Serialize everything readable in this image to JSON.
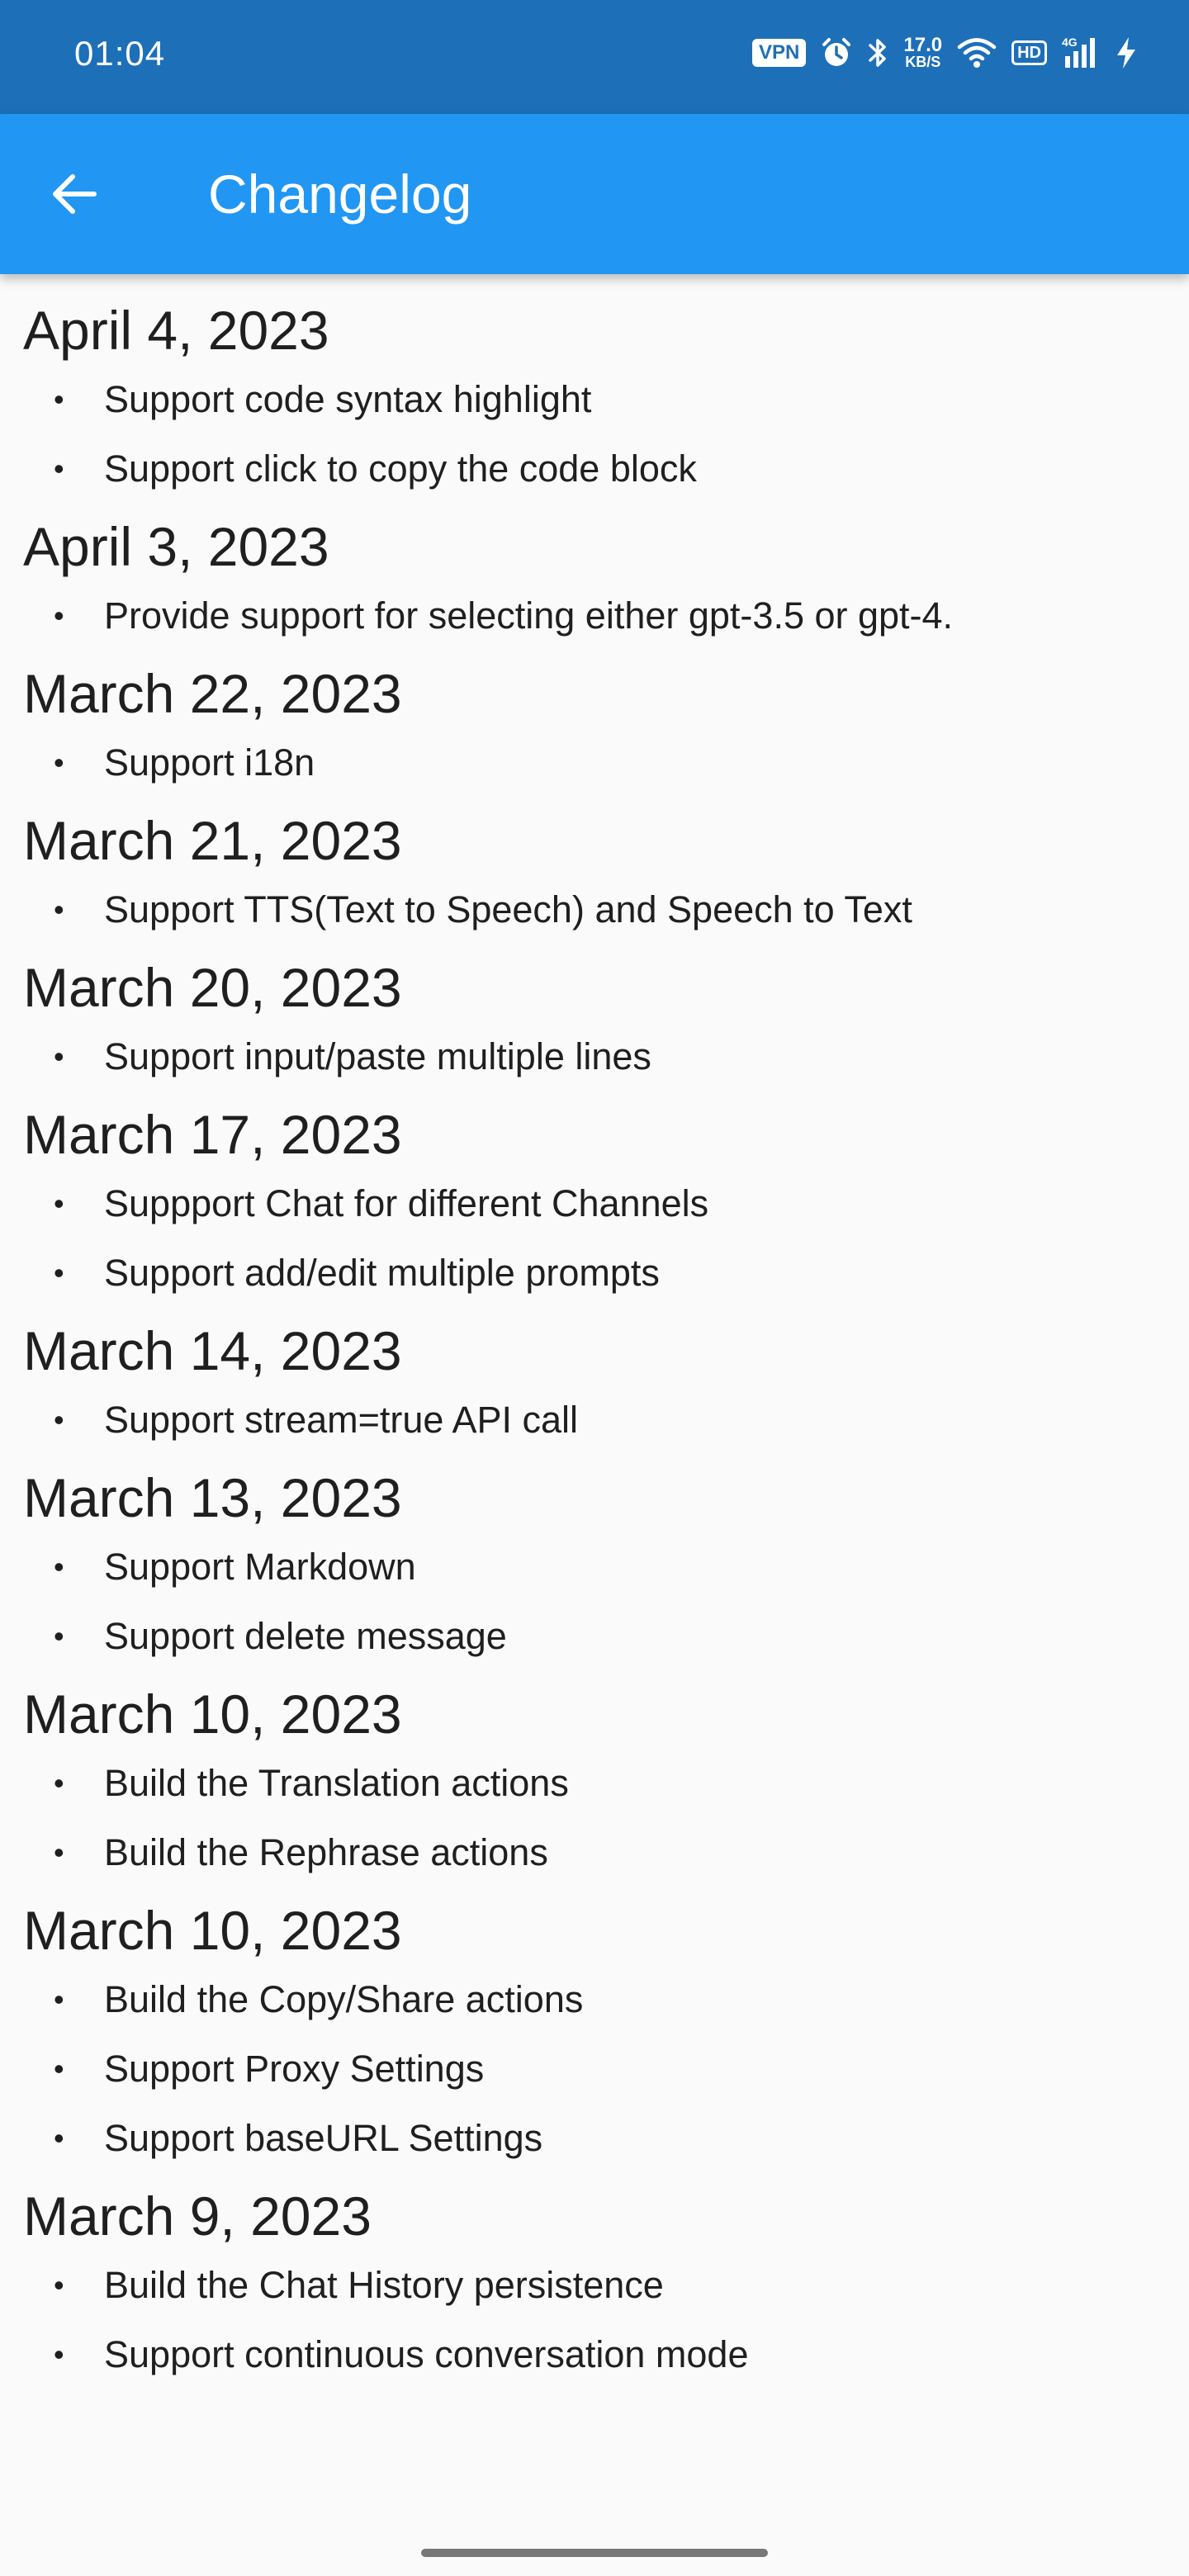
{
  "status_bar": {
    "time": "01:04",
    "vpn_label": "VPN",
    "net_speed_value": "17.0",
    "net_speed_unit": "KB/S",
    "hd_label": "HD",
    "network_label": "4G",
    "icons": [
      "vpn-icon",
      "alarm-icon",
      "bluetooth-icon",
      "net-speed-icon",
      "wifi-icon",
      "hd-icon",
      "signal-4g-icon",
      "charging-icon"
    ]
  },
  "app_bar": {
    "title": "Changelog",
    "back_icon": "arrow-left-icon"
  },
  "changelog": [
    {
      "date": "April 4, 2023",
      "items": [
        "Support code syntax highlight",
        "Support click to copy the code block"
      ]
    },
    {
      "date": "April 3, 2023",
      "items": [
        "Provide support for selecting either gpt-3.5 or gpt-4."
      ]
    },
    {
      "date": "March 22, 2023",
      "items": [
        "Support i18n"
      ]
    },
    {
      "date": "March 21, 2023",
      "items": [
        "Support TTS(Text to Speech) and Speech to Text"
      ]
    },
    {
      "date": "March 20, 2023",
      "items": [
        "Support input/paste multiple lines"
      ]
    },
    {
      "date": "March 17, 2023",
      "items": [
        "Suppport Chat for different Channels",
        "Support add/edit multiple prompts"
      ]
    },
    {
      "date": "March 14, 2023",
      "items": [
        "Support stream=true API call"
      ]
    },
    {
      "date": "March 13, 2023",
      "items": [
        "Support Markdown",
        "Support delete message"
      ]
    },
    {
      "date": "March 10, 2023",
      "items": [
        "Build the Translation actions",
        "Build the Rephrase actions"
      ]
    },
    {
      "date": "March 10, 2023",
      "items": [
        "Build the Copy/Share actions",
        "Support Proxy Settings",
        "Support baseURL Settings"
      ]
    },
    {
      "date": "March 9, 2023",
      "items": [
        "Build the Chat History persistence",
        "Support continuous conversation mode"
      ]
    }
  ],
  "bullet_char": "•",
  "colors": {
    "status_bar": "#1d6fb8",
    "app_bar": "#2196f3",
    "background": "#fafafa",
    "text": "#1f1f1f"
  }
}
